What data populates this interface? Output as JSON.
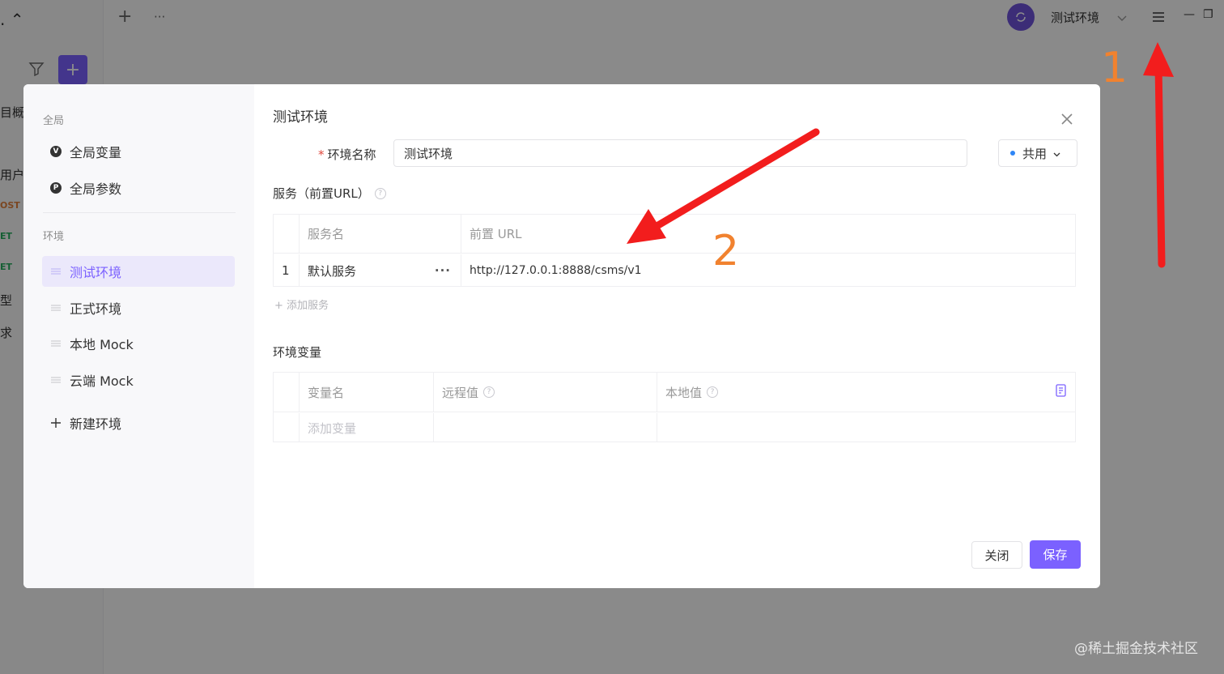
{
  "app": {
    "bg_side_texts": [
      "目概",
      "用户",
      "型",
      "求"
    ],
    "bg_methods": [
      "OST",
      "ET",
      "ET"
    ],
    "env_switcher_label": "测试环境",
    "topbar_plus": "+",
    "topbar_more": "···"
  },
  "modal": {
    "title": "测试环境",
    "sidebar": {
      "global_group": "全局",
      "global_items": [
        {
          "label": "全局变量",
          "badge": "V"
        },
        {
          "label": "全局参数",
          "badge": "P"
        }
      ],
      "env_group": "环境",
      "env_items": [
        {
          "label": "测试环境",
          "active": true
        },
        {
          "label": "正式环境"
        },
        {
          "label": "本地 Mock"
        },
        {
          "label": "云端 Mock"
        }
      ],
      "new_env_label": "新建环境"
    },
    "form": {
      "required_mark": "*",
      "name_label": "环境名称",
      "name_value": "测试环境",
      "share_option": "共用"
    },
    "services": {
      "title": "服务（前置URL）",
      "columns": [
        "服务名",
        "前置 URL"
      ],
      "rows": [
        {
          "index": "1",
          "name": "默认服务",
          "url": "http://127.0.0.1:8888/csms/v1",
          "more": "···"
        }
      ],
      "add_label": "+ 添加服务"
    },
    "variables": {
      "title": "环境变量",
      "columns": [
        "变量名",
        "远程值",
        "本地值"
      ],
      "add_placeholder": "添加变量"
    },
    "buttons": {
      "close": "关闭",
      "save": "保存"
    }
  },
  "annotations": {
    "marker_1": "1",
    "marker_2": "2",
    "arrow_color": "#f21d1d",
    "number_color": "#f1822f"
  },
  "watermark": "@稀土掘金技术社区",
  "colors": {
    "accent": "#7b61ff",
    "danger": "#e0483c",
    "blue_dot": "#2f86f6"
  }
}
